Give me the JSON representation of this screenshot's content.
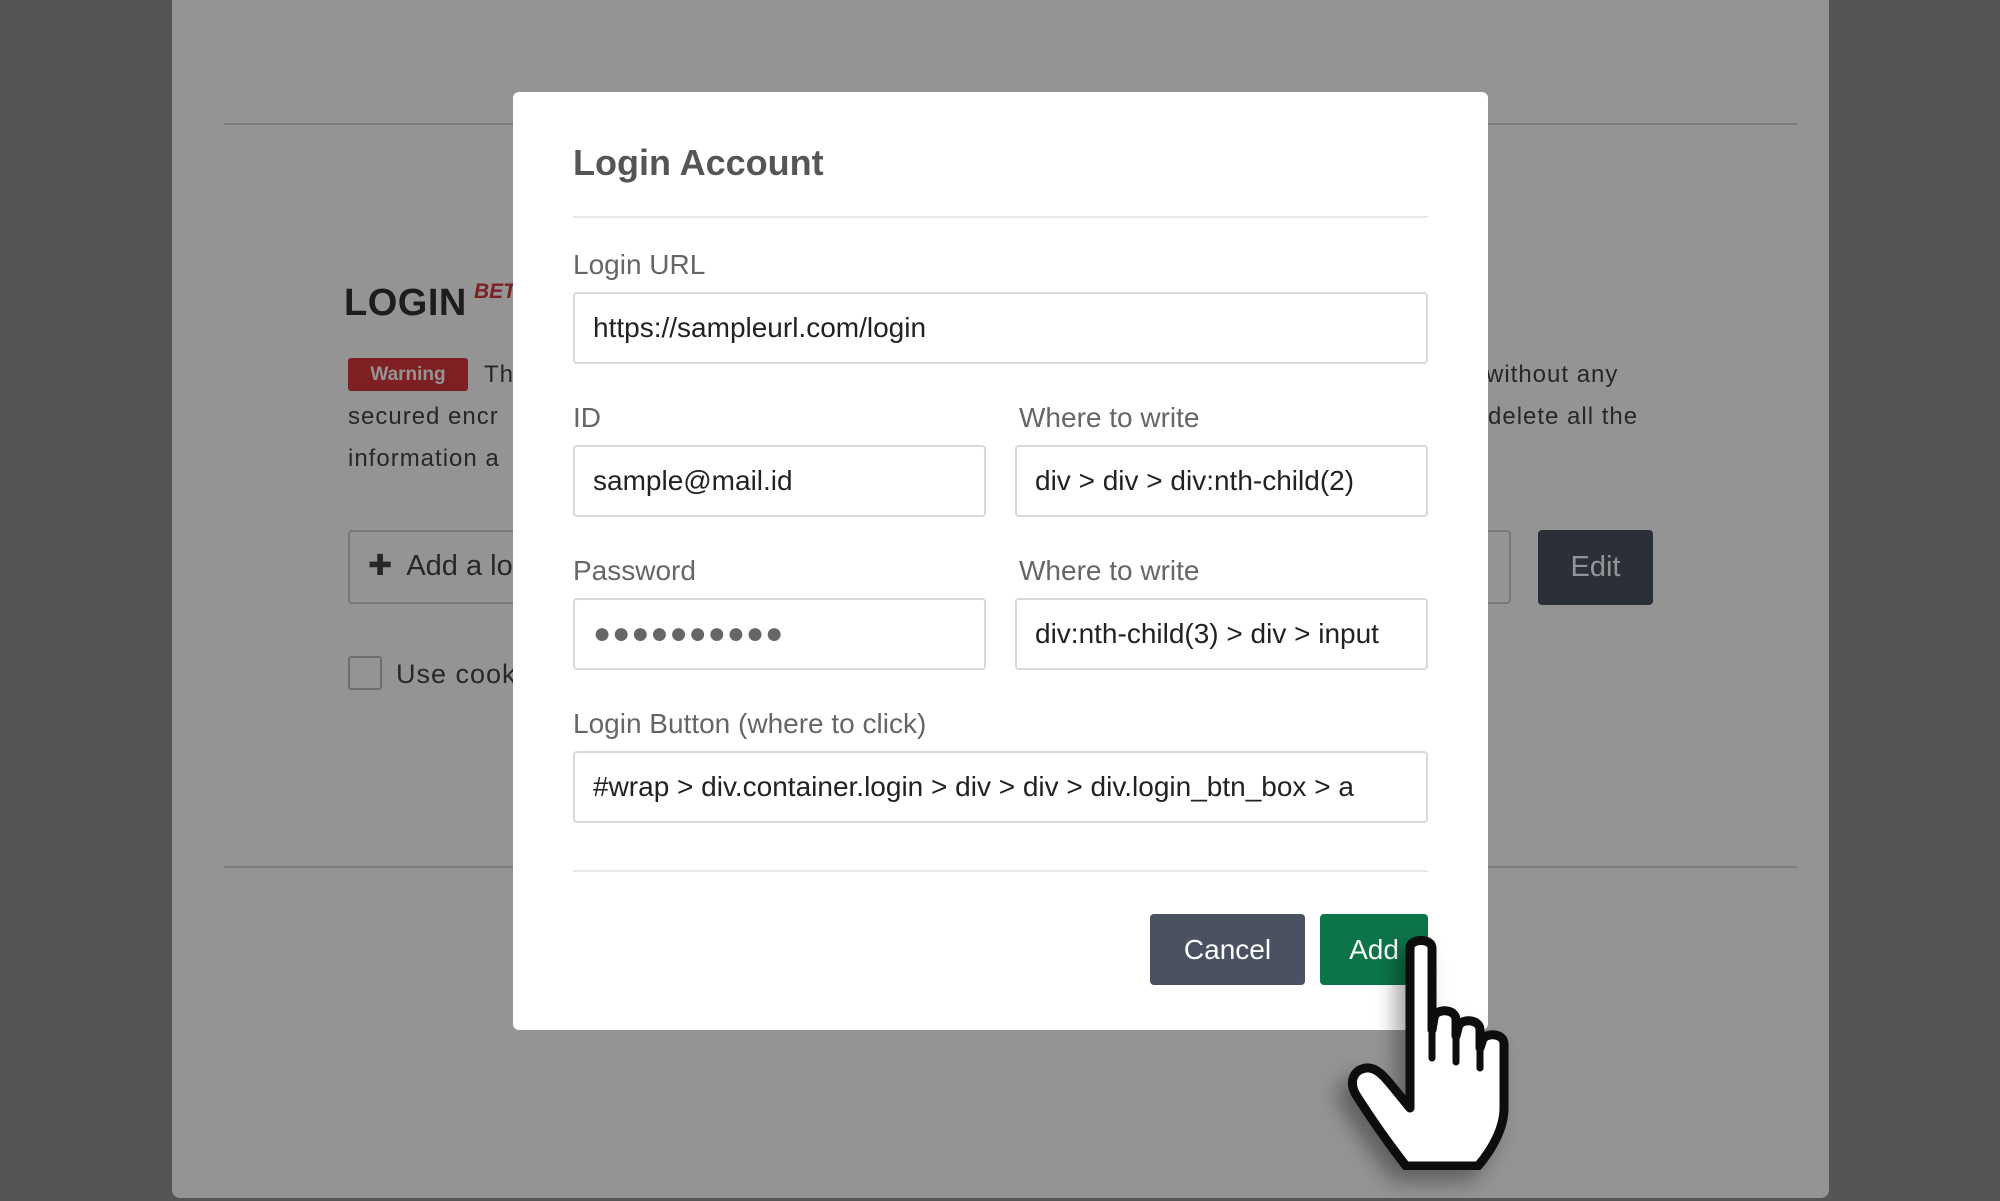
{
  "background": {
    "section_title": "LOGIN",
    "beta_badge": "BET",
    "warning_badge": "Warning",
    "warning_text_line1_left": "Th",
    "warning_text_line1_right": "without any",
    "warning_text_line2_left": "secured encr",
    "warning_text_line2_right": "delete all the",
    "warning_text_line3_left": "information a",
    "add_login_label": "Add a lo",
    "edit_button": "Edit",
    "cookie_checkbox_label": "Use cook"
  },
  "modal": {
    "title": "Login Account",
    "login_url": {
      "label": "Login URL",
      "value": "https://sampleurl.com/login"
    },
    "id": {
      "label": "ID",
      "value": "sample@mail.id"
    },
    "id_selector": {
      "label": "Where to write",
      "value": "div > div > div:nth-child(2)"
    },
    "password": {
      "label": "Password",
      "value": "●●●●●●●●●●"
    },
    "password_selector": {
      "label": "Where to write",
      "value": "div:nth-child(3) > div > input"
    },
    "login_button": {
      "label": "Login Button (where to click)",
      "value": "#wrap > div.container.login > div > div > div.login_btn_box > a"
    },
    "cancel_button": "Cancel",
    "add_button": "Add"
  },
  "colors": {
    "warning": "#d9363e",
    "add_button": "#0d7447",
    "cancel_button": "#4a5160",
    "overlay": "#939393"
  },
  "icons": {
    "add_icon": "plus-icon",
    "cursor": "hand-pointer-icon"
  }
}
